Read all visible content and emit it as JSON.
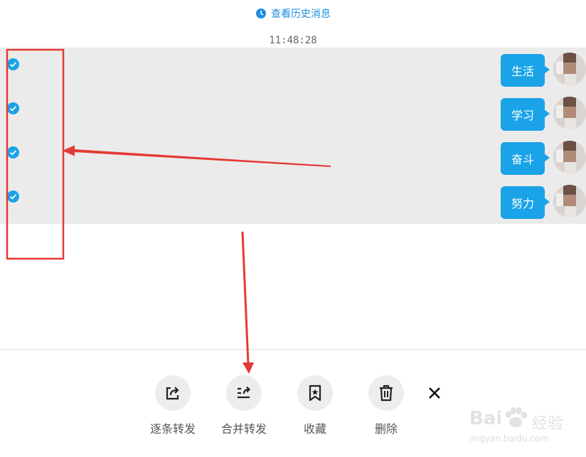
{
  "history": {
    "label": "查看历史消息",
    "icon": "clock-icon"
  },
  "timestamp": "11:48:28",
  "messages": [
    {
      "text": "生活",
      "selected": true
    },
    {
      "text": "学习",
      "selected": true
    },
    {
      "text": "奋斗",
      "selected": true
    },
    {
      "text": "努力",
      "selected": true
    }
  ],
  "actions": [
    {
      "label": "逐条转发",
      "icon": "forward-one-by-one-icon"
    },
    {
      "label": "合并转发",
      "icon": "merge-forward-icon"
    },
    {
      "label": "收藏",
      "icon": "bookmark-star-icon"
    },
    {
      "label": "删除",
      "icon": "trash-icon"
    }
  ],
  "close_icon": "close-icon",
  "watermark": {
    "brand": "Bai",
    "brand_cn": "经验",
    "url": "jingyan.baidu.com"
  },
  "colors": {
    "accent": "#1aa3e8",
    "link": "#1e8fe0",
    "annotation": "#e53935",
    "selection_bg": "#ebebeb"
  }
}
